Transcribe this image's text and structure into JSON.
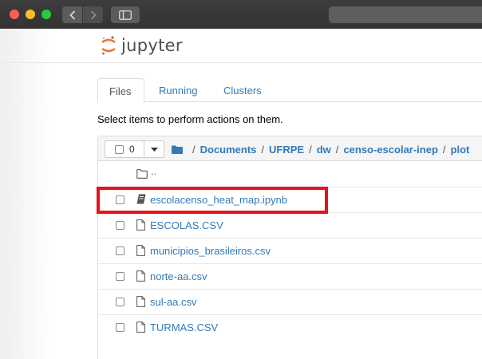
{
  "window": {
    "traffic_lights": [
      "#fd5f57",
      "#febc2e",
      "#28c840"
    ]
  },
  "header": {
    "logo_text": "jupyter"
  },
  "tabs": [
    {
      "label": "Files",
      "active": true
    },
    {
      "label": "Running",
      "active": false
    },
    {
      "label": "Clusters",
      "active": false
    }
  ],
  "instructions": "Select items to perform actions on them.",
  "toolbar": {
    "selected_count": "0"
  },
  "breadcrumb": [
    "Documents",
    "UFRPE",
    "dw",
    "censo-escolar-inep",
    "plot"
  ],
  "files": [
    {
      "name": "..",
      "icon": "folder-icon",
      "type": "updir"
    },
    {
      "name": "escolacenso_heat_map.ipynb",
      "icon": "notebook-icon",
      "type": "notebook",
      "highlighted": true
    },
    {
      "name": "ESCOLAS.CSV",
      "icon": "file-icon",
      "type": "file"
    },
    {
      "name": "municipios_brasileiros.csv",
      "icon": "file-icon",
      "type": "file"
    },
    {
      "name": "norte-aa.csv",
      "icon": "file-icon",
      "type": "file"
    },
    {
      "name": "sul-aa.csv",
      "icon": "file-icon",
      "type": "file"
    },
    {
      "name": "TURMAS.CSV",
      "icon": "file-icon",
      "type": "file"
    }
  ],
  "colors": {
    "link": "#337ab7",
    "highlight": "#e8101a",
    "logo_orange": "#f37726"
  }
}
